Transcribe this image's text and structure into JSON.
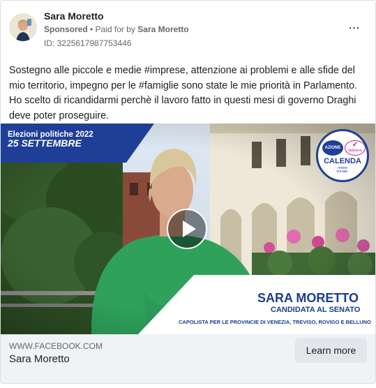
{
  "post": {
    "page_name": "Sara Moretto",
    "sponsored_label": "Sponsored",
    "paid_for_prefix": "• Paid for by",
    "paid_for_name": "Sara Moretto",
    "ad_id": "ID: 3225617987753446",
    "more_icon": "⋯",
    "text": "Sostegno alle piccole e medie #imprese, attenzione ai problemi e alle sfide del mio territorio, impegno per le #famiglie sono state le mie priorità in Parlamento. Ho scelto di ricandidarmi perchè il lavoro fatto in questi mesi di governo Draghi deve poter proseguire."
  },
  "video": {
    "banner_line1": "Elezioni politiche 2022",
    "banner_line2": "25 SETTEMBRE",
    "logo_azione": "AZIONE",
    "logo_iv": "italiaviva",
    "logo_main": "CALENDA",
    "logo_sub1": "renew",
    "logo_sub2": "europe.",
    "candidate_name": "SARA MORETTO",
    "candidate_role": "CANDIDATA AL SENATO",
    "candidate_desc": "CAPOLISTA PER LE PROVINCIE DI VENEZIA, TREVISO, ROVIGO E BELLUNO"
  },
  "footer": {
    "domain": "WWW.FACEBOOK.COM",
    "title": "Sara Moretto",
    "cta_label": "Learn more"
  },
  "colors": {
    "banner_blue": "#1f3f97",
    "accent_blue": "#1a3d8f",
    "logo_green": "#2aa84a",
    "logo_magenta": "#c2187a"
  }
}
